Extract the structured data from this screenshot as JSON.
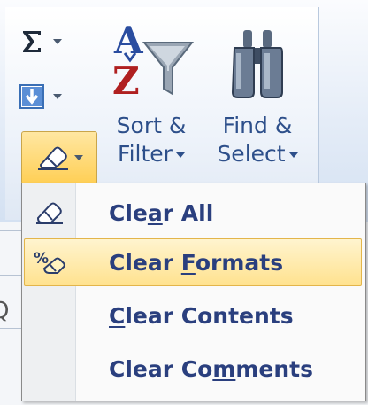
{
  "ribbon": {
    "sort_filter": {
      "line1": "Sort &",
      "line2": "Filter"
    },
    "find_select": {
      "line1": "Find &",
      "line2": "Select"
    }
  },
  "clear_menu": {
    "items": [
      {
        "pre": "Cle",
        "acc": "a",
        "post": "r All",
        "icon": "eraser-icon",
        "highlighted": false
      },
      {
        "pre": "Clear ",
        "acc": "F",
        "post": "ormats",
        "icon": "clear-formats-icon",
        "highlighted": true
      },
      {
        "pre": "",
        "acc": "C",
        "post": "lear Contents",
        "icon": "",
        "highlighted": false
      },
      {
        "pre": "Clear Co",
        "acc": "m",
        "post": "ments",
        "icon": "",
        "highlighted": false
      }
    ]
  },
  "background_fragment": "Q",
  "colors": {
    "label_blue": "#2d4f8a",
    "menu_text": "#2a3f7e",
    "highlight": "#ffe28f"
  }
}
